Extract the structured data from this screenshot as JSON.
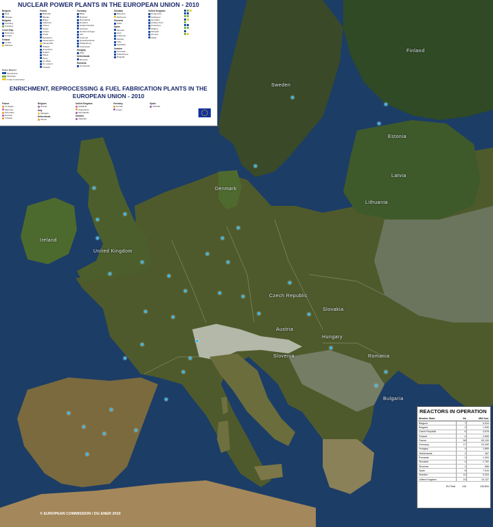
{
  "map": {
    "water_color": "#1c3d66",
    "land_color": "#4d5a2c",
    "country_labels": [
      "Sweden",
      "Finland",
      "Estonia",
      "Latvia",
      "Lithuania",
      "Denmark",
      "Ireland",
      "United Kingdom",
      "Czech Republic",
      "Slovakia",
      "Austria",
      "Hungary",
      "Romania",
      "Bulgaria",
      "Slovenia"
    ],
    "copyright": "© EUROPEAN COMMISSION / DG ENER     2010"
  },
  "legend": {
    "title": "NUCLEAR POWER PLANTS IN THE EUROPEAN UNION - 2010",
    "subtitle": "ENRICHMENT, REPROCESSING & FUEL FABRICATION PLANTS IN THE EUROPEAN UNION - 2010",
    "columns": [
      {
        "items": [
          {
            "country": "Belgium",
            "rows": [
              "Doel",
              "Tihange"
            ]
          },
          {
            "country": "Bulgaria",
            "rows": [
              "Kozloduy",
              "Kozloduy"
            ]
          },
          {
            "country": "Czech Rep.",
            "rows": [
              "Dukovany",
              "Temelin"
            ]
          },
          {
            "country": "Finland",
            "rows": [
              "Loviisa",
              "Olkiluoto"
            ]
          }
        ]
      },
      {
        "items": [
          {
            "country": "France",
            "rows": [
              "Belleville",
              "Blayais",
              "Bugey",
              "Cattenom",
              "Chinon",
              "Chooz",
              "Civaux",
              "Cruas",
              "Dampierre",
              "Fessenheim",
              "Flamanville",
              "Golfech",
              "Gravelines",
              "Nogent",
              "Paluel",
              "Penly",
              "St. Alban",
              "St. Laurent",
              "Tricastin"
            ]
          }
        ]
      },
      {
        "items": [
          {
            "country": "Germany",
            "rows": [
              "Biblis",
              "Brokdorf",
              "Brunsbüttel",
              "Emsland",
              "Grafenrheinfeld",
              "Grohnde",
              "Gundremmingen",
              "Isar",
              "Krümmel",
              "Neckarwestheim",
              "Philippsburg",
              "Unterweser"
            ]
          },
          {
            "country": "Hungary",
            "rows": [
              "Paks"
            ]
          },
          {
            "country": "Netherlands",
            "rows": [
              "Borssele"
            ]
          },
          {
            "country": "Romania",
            "rows": [
              "Cernavoda"
            ]
          }
        ]
      },
      {
        "items": [
          {
            "country": "Slovakia",
            "rows": [
              "Bohunice",
              "Mochovce"
            ]
          },
          {
            "country": "Slovenia",
            "rows": [
              "Krško"
            ]
          },
          {
            "country": "Spain",
            "rows": [
              "Almaraz",
              "Ascó",
              "Cofrentes",
              "Garoña",
              "Trillo",
              "Vandellós"
            ]
          },
          {
            "country": "Sweden",
            "rows": [
              "Forsmark",
              "Oskarshamn",
              "Ringhals"
            ]
          }
        ]
      },
      {
        "items": [
          {
            "country": "United Kingdom",
            "rows": [
              "Dungeness",
              "Hartlepool",
              "Heysham",
              "Hinkley Point",
              "Hunterston",
              "Oldbury",
              "Sizewell",
              "Torness",
              "Wylfa"
            ]
          }
        ]
      }
    ],
    "power_legend": [
      "Power Reactor",
      "Operational",
      "Shutdown",
      "Under Construction"
    ],
    "fuel_columns": [
      {
        "country": "France",
        "rows": [
          "La Hague",
          "Marcoule",
          "Pierrelatte",
          "Romans",
          "Tricastin"
        ]
      },
      {
        "country": "Belgium",
        "rows": [
          "Dessel"
        ]
      },
      {
        "country": "Italy",
        "rows": [
          "Saluggia"
        ]
      },
      {
        "country": "Netherlands",
        "rows": [
          "Almelo"
        ]
      },
      {
        "country": "United Kingdom",
        "rows": [
          "Sellafield",
          "Capenhurst",
          "Springfields"
        ]
      },
      {
        "country": "Sweden",
        "rows": [
          "Västerås"
        ]
      },
      {
        "country": "Germany",
        "rows": [
          "Gronau",
          "Lingen"
        ]
      },
      {
        "country": "Spain",
        "rows": [
          "Juzbado"
        ]
      }
    ],
    "colors": {
      "operational": "#1f4fa8",
      "shutdown": "#7ab648",
      "construction": "#e8c93a"
    }
  },
  "reactors": {
    "title": "REACTORS IN OPERATION",
    "headers": [
      "Member State",
      "No",
      "MW Inst."
    ],
    "rows": [
      [
        "Belgium",
        "7",
        "5,934"
      ],
      [
        "Bulgaria",
        "2",
        "1,906"
      ],
      [
        "Czech Republic",
        "6",
        "3,678"
      ],
      [
        "Finland",
        "4",
        "2,696"
      ],
      [
        "France",
        "58",
        "63,130"
      ],
      [
        "Germany",
        "17",
        "20,490"
      ],
      [
        "Hungary",
        "4",
        "1,889"
      ],
      [
        "Netherlands",
        "1",
        "487"
      ],
      [
        "Romania",
        "2",
        "1,300"
      ],
      [
        "Slovakia",
        "4",
        "1,762"
      ],
      [
        "Slovenia",
        "1",
        "666"
      ],
      [
        "Spain",
        "8",
        "7,516"
      ],
      [
        "Sweden",
        "10",
        "9,303"
      ],
      [
        "United Kingdom",
        "19",
        "10,137"
      ]
    ],
    "total": [
      "EU Total",
      "143",
      "130,894"
    ]
  }
}
